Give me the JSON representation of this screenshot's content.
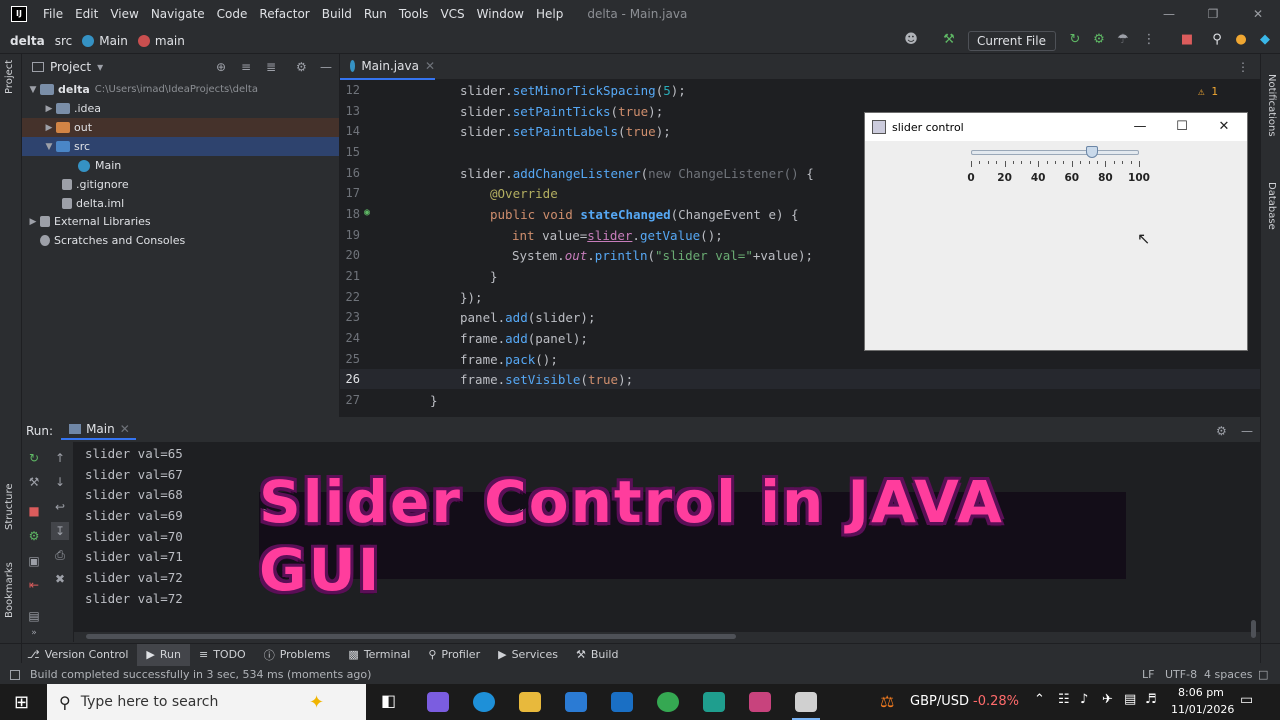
{
  "titlebar": {
    "logo": "IJ",
    "menus": [
      "File",
      "Edit",
      "View",
      "Navigate",
      "Code",
      "Refactor",
      "Build",
      "Run",
      "Tools",
      "VCS",
      "Window",
      "Help"
    ],
    "window_title": "delta - Main.java"
  },
  "navbar": {
    "crumbs": [
      "delta",
      "src",
      "Main",
      "main"
    ],
    "run_config": "Current File"
  },
  "project": {
    "header": "Project",
    "tree": [
      {
        "label": "delta",
        "path": "C:\\Users\\imad\\IdeaProjects\\delta"
      },
      {
        "label": ".idea"
      },
      {
        "label": "out"
      },
      {
        "label": "src"
      },
      {
        "label": "Main"
      },
      {
        "label": ".gitignore"
      },
      {
        "label": "delta.iml"
      },
      {
        "label": "External Libraries"
      },
      {
        "label": "Scratches and Consoles"
      }
    ]
  },
  "editor": {
    "tab": "Main.java",
    "inspection": "1",
    "line_numbers": [
      "12",
      "13",
      "14",
      "15",
      "16",
      "17",
      "18",
      "19",
      "20",
      "21",
      "22",
      "23",
      "24",
      "25",
      "26",
      "27"
    ]
  },
  "swing": {
    "title": "slider control",
    "slider": {
      "min": 0,
      "max": 100,
      "value": 72
    },
    "tick_labels": [
      "0",
      "20",
      "40",
      "60",
      "80",
      "100"
    ]
  },
  "run": {
    "label": "Run:",
    "tab": "Main",
    "output": [
      "slider val=65",
      "slider val=67",
      "slider val=68",
      "slider val=69",
      "slider val=70",
      "slider val=71",
      "slider val=72",
      "slider val=72"
    ]
  },
  "banner": {
    "text": "Slider Control in JAVA GUI"
  },
  "tooltabs": [
    "Version Control",
    "Run",
    "TODO",
    "Problems",
    "Terminal",
    "Profiler",
    "Services",
    "Build"
  ],
  "sidebar": {
    "left": [
      "Project",
      "Structure",
      "Bookmarks"
    ],
    "right": [
      "Notifications",
      "Database"
    ]
  },
  "status": {
    "message": "Build completed successfully in 3 sec, 534 ms (moments ago)",
    "line_sep": "LF",
    "encoding": "UTF-8",
    "indent": "4 spaces"
  },
  "taskbar": {
    "search_placeholder": "Type here to search",
    "ticker": "GBP/USD",
    "ticker_change": "-0.28%",
    "time": "8:06 pm",
    "date": "11/01/2026"
  }
}
